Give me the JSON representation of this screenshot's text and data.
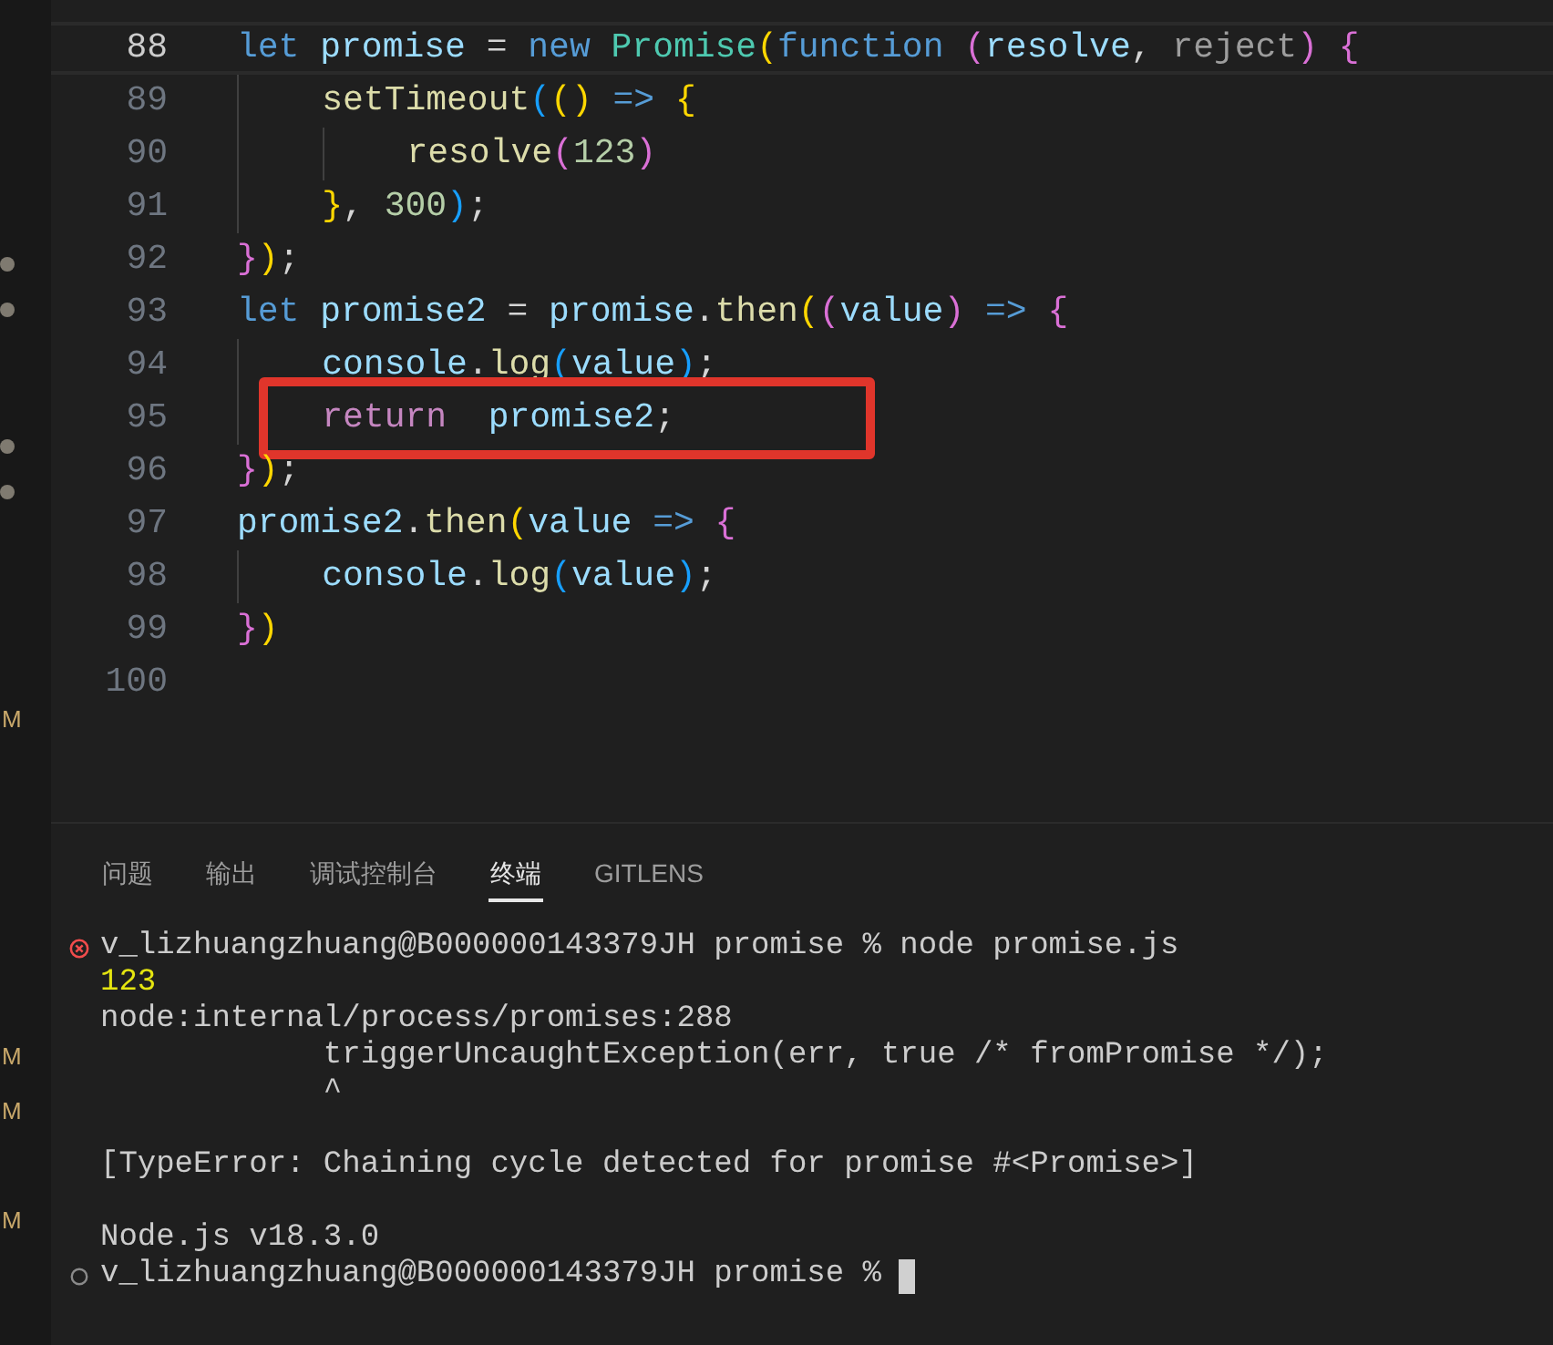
{
  "sidebar": {
    "markers": [
      {
        "kind": "dot"
      },
      {
        "kind": "dot"
      },
      {
        "kind": "dot"
      },
      {
        "kind": "dot"
      },
      {
        "kind": "letter",
        "text": "M"
      },
      {
        "kind": "letter",
        "text": "M"
      },
      {
        "kind": "letter",
        "text": "M"
      },
      {
        "kind": "letter",
        "text": "M"
      }
    ]
  },
  "editor": {
    "lines": [
      {
        "number": "88",
        "current": true,
        "boxed": false,
        "tokens": [
          {
            "text": "let ",
            "kind": "keyword"
          },
          {
            "text": "promise",
            "kind": "variable"
          },
          {
            "text": " = ",
            "kind": "plain"
          },
          {
            "text": "new ",
            "kind": "keyword"
          },
          {
            "text": "Promise",
            "kind": "class"
          },
          {
            "text": "(",
            "kind": "bracket1"
          },
          {
            "text": "function ",
            "kind": "keyword"
          },
          {
            "text": "(",
            "kind": "bracket2"
          },
          {
            "text": "resolve",
            "kind": "variable"
          },
          {
            "text": ", ",
            "kind": "plain"
          },
          {
            "text": "reject",
            "kind": "unused"
          },
          {
            "text": ") {",
            "kind": "bracket2"
          }
        ]
      },
      {
        "number": "89",
        "current": false,
        "boxed": false,
        "tokens": [
          {
            "text": "    setTimeout",
            "kind": "function"
          },
          {
            "text": "(",
            "kind": "bracket3"
          },
          {
            "text": "() ",
            "kind": "bracket1"
          },
          {
            "text": "=> ",
            "kind": "keyword"
          },
          {
            "text": "{",
            "kind": "bracket1"
          }
        ]
      },
      {
        "number": "90",
        "current": false,
        "boxed": false,
        "tokens": [
          {
            "text": "        resolve",
            "kind": "function"
          },
          {
            "text": "(",
            "kind": "bracket2"
          },
          {
            "text": "123",
            "kind": "number"
          },
          {
            "text": ")",
            "kind": "bracket2"
          }
        ]
      },
      {
        "number": "91",
        "current": false,
        "boxed": false,
        "tokens": [
          {
            "text": "    }",
            "kind": "bracket1"
          },
          {
            "text": ", ",
            "kind": "plain"
          },
          {
            "text": "300",
            "kind": "number"
          },
          {
            "text": ")",
            "kind": "bracket3"
          },
          {
            "text": ";",
            "kind": "plain"
          }
        ]
      },
      {
        "number": "92",
        "current": false,
        "boxed": false,
        "tokens": [
          {
            "text": "}",
            "kind": "bracket2"
          },
          {
            "text": ")",
            "kind": "bracket1"
          },
          {
            "text": ";",
            "kind": "plain"
          }
        ]
      },
      {
        "number": "93",
        "current": false,
        "boxed": false,
        "tokens": [
          {
            "text": "let ",
            "kind": "keyword"
          },
          {
            "text": "promise2",
            "kind": "variable"
          },
          {
            "text": " = ",
            "kind": "plain"
          },
          {
            "text": "promise",
            "kind": "variable"
          },
          {
            "text": ".",
            "kind": "plain"
          },
          {
            "text": "then",
            "kind": "function"
          },
          {
            "text": "(",
            "kind": "bracket1"
          },
          {
            "text": "(",
            "kind": "bracket2"
          },
          {
            "text": "value",
            "kind": "variable"
          },
          {
            "text": ") ",
            "kind": "bracket2"
          },
          {
            "text": "=> ",
            "kind": "keyword"
          },
          {
            "text": "{",
            "kind": "bracket2"
          }
        ]
      },
      {
        "number": "94",
        "current": false,
        "boxed": false,
        "tokens": [
          {
            "text": "    console",
            "kind": "variable"
          },
          {
            "text": ".",
            "kind": "plain"
          },
          {
            "text": "log",
            "kind": "function"
          },
          {
            "text": "(",
            "kind": "bracket3"
          },
          {
            "text": "value",
            "kind": "variable"
          },
          {
            "text": ")",
            "kind": "bracket3"
          },
          {
            "text": ";",
            "kind": "plain"
          }
        ]
      },
      {
        "number": "95",
        "current": false,
        "boxed": true,
        "tokens": [
          {
            "text": "    return  ",
            "kind": "control"
          },
          {
            "text": "promise2",
            "kind": "variable"
          },
          {
            "text": ";",
            "kind": "plain"
          }
        ]
      },
      {
        "number": "96",
        "current": false,
        "boxed": false,
        "tokens": [
          {
            "text": "}",
            "kind": "bracket2"
          },
          {
            "text": ")",
            "kind": "bracket1"
          },
          {
            "text": ";",
            "kind": "plain"
          }
        ]
      },
      {
        "number": "97",
        "current": false,
        "boxed": false,
        "tokens": [
          {
            "text": "promise2",
            "kind": "variable"
          },
          {
            "text": ".",
            "kind": "plain"
          },
          {
            "text": "then",
            "kind": "function"
          },
          {
            "text": "(",
            "kind": "bracket1"
          },
          {
            "text": "value ",
            "kind": "variable"
          },
          {
            "text": "=> ",
            "kind": "keyword"
          },
          {
            "text": "{",
            "kind": "bracket2"
          }
        ]
      },
      {
        "number": "98",
        "current": false,
        "boxed": false,
        "tokens": [
          {
            "text": "    console",
            "kind": "variable"
          },
          {
            "text": ".",
            "kind": "plain"
          },
          {
            "text": "log",
            "kind": "function"
          },
          {
            "text": "(",
            "kind": "bracket3"
          },
          {
            "text": "value",
            "kind": "variable"
          },
          {
            "text": ")",
            "kind": "bracket3"
          },
          {
            "text": ";",
            "kind": "plain"
          }
        ]
      },
      {
        "number": "99",
        "current": false,
        "boxed": false,
        "tokens": [
          {
            "text": "}",
            "kind": "bracket2"
          },
          {
            "text": ")",
            "kind": "bracket1"
          }
        ]
      },
      {
        "number": "100",
        "current": false,
        "boxed": false
      }
    ]
  },
  "panel": {
    "tabs": [
      {
        "label": "问题",
        "selected": false
      },
      {
        "label": "输出",
        "selected": false
      },
      {
        "label": "调试控制台",
        "selected": false
      },
      {
        "label": "终端",
        "selected": true
      },
      {
        "label": "GITLENS",
        "selected": false
      }
    ],
    "terminal": [
      {
        "kind": "prompt",
        "error": true,
        "text": "v_lizhuangzhuang@B000000143379JH promise % node promise.js",
        "cursor": false
      },
      {
        "kind": "number",
        "text": "123"
      },
      {
        "kind": "output",
        "text": "node:internal/process/promises:288"
      },
      {
        "kind": "output",
        "text": "            triggerUncaughtException(err, true /* fromPromise */);"
      },
      {
        "kind": "output",
        "text": "            ^"
      },
      {
        "kind": "blank"
      },
      {
        "kind": "output",
        "text": "[TypeError: Chaining cycle detected for promise #<Promise>]"
      },
      {
        "kind": "blank"
      },
      {
        "kind": "output",
        "text": "Node.js v18.3.0"
      },
      {
        "kind": "prompt",
        "error": false,
        "text": "v_lizhuangzhuang@B000000143379JH promise %",
        "cursor": true
      }
    ]
  }
}
